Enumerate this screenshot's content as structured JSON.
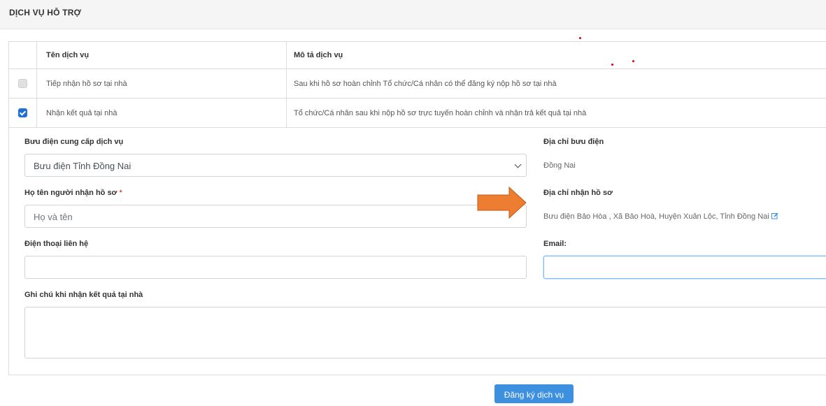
{
  "section": {
    "title": "DỊCH VỤ HỖ TRỢ"
  },
  "table": {
    "headers": {
      "name": "Tên dịch vụ",
      "description": "Mô tả dịch vụ"
    },
    "rows": [
      {
        "checked": false,
        "name": "Tiếp nhận hồ sơ tại nhà",
        "description": "Sau khi hồ sơ hoàn chỉnh Tổ chức/Cá nhân có thể đăng ký nộp hồ sơ tại nhà"
      },
      {
        "checked": true,
        "name": "Nhận kết quả tại nhà",
        "description": "Tổ chức/Cá nhân sau khi nộp hồ sơ trực tuyến hoàn chỉnh và nhận trả kết quả tại nhà"
      }
    ]
  },
  "form": {
    "post_office": {
      "label": "Bưu điện cung cấp dịch vụ",
      "selected": "Bưu điện Tỉnh Đồng Nai"
    },
    "post_office_address": {
      "label": "Địa chỉ bưu điện",
      "value": "Đồng Nai"
    },
    "recipient_name": {
      "label": "Họ tên người nhận hồ sơ",
      "required_mark": "*",
      "placeholder": "Họ và tên",
      "value": ""
    },
    "receive_address": {
      "label": "Địa chỉ nhận hồ sơ",
      "value": "Bưu điện Bảo Hòa , Xã Bảo Hoà, Huyện Xuân Lộc, Tỉnh Đồng Nai",
      "edit_icon": "edit-icon"
    },
    "phone": {
      "label": "Điện thoại liên hệ",
      "value": ""
    },
    "email": {
      "label": "Email:",
      "value": ""
    },
    "note": {
      "label": "Ghi chú khi nhận kết quả tại nhà",
      "value": ""
    }
  },
  "submit_label": "Đăng ký dịch vụ",
  "colors": {
    "primary": "#3d8fe0",
    "checkbox_on": "#1f6fd8",
    "arrow": "#ed7d31",
    "required": "#e00000"
  }
}
